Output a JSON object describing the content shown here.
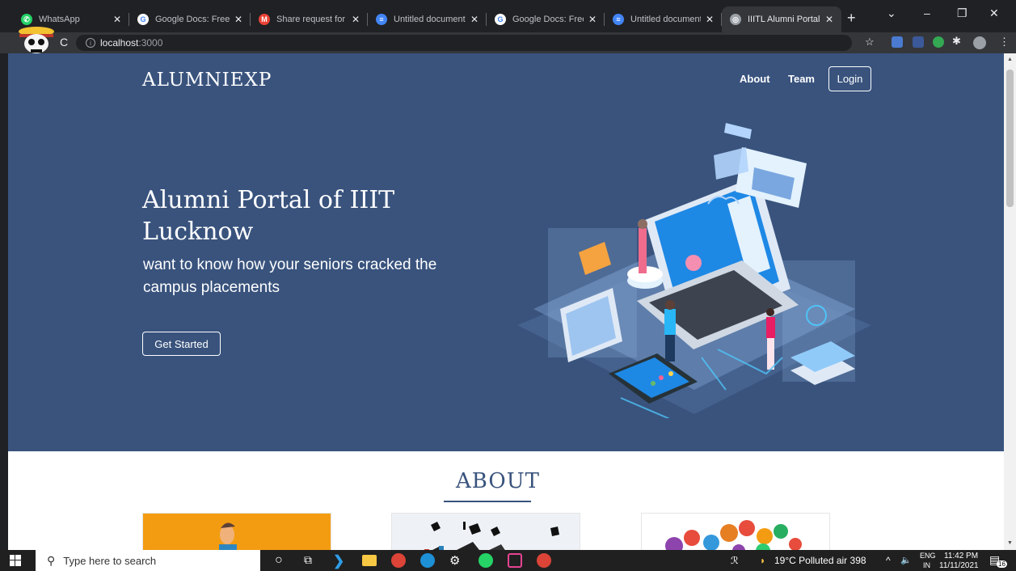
{
  "browser": {
    "tabs": [
      {
        "title": "WhatsApp",
        "icon": "whatsapp-icon",
        "color": "#25d366",
        "glyph": "✆"
      },
      {
        "title": "Google Docs: Free On",
        "icon": "google-icon",
        "color": "#ffffff",
        "glyph": "G"
      },
      {
        "title": "Share request for \"Un",
        "icon": "gmail-icon",
        "color": "#ea4335",
        "glyph": "M"
      },
      {
        "title": "Untitled document - G",
        "icon": "docs-icon",
        "color": "#4285f4",
        "glyph": "≡"
      },
      {
        "title": "Google Docs: Free On",
        "icon": "google-icon",
        "color": "#ffffff",
        "glyph": "G"
      },
      {
        "title": "Untitled document - G",
        "icon": "docs-icon",
        "color": "#4285f4",
        "glyph": "≡"
      },
      {
        "title": "IIITL Alumni Portal",
        "icon": "globe-icon",
        "color": "#9aa0a6",
        "glyph": "◎"
      }
    ],
    "new_tab": "+",
    "url_host": "localhost",
    "url_port": ":3000"
  },
  "site": {
    "brand": "ALUMNIEXP",
    "nav": {
      "about": "About",
      "team": "Team",
      "login": "Login"
    },
    "hero": {
      "title": "Alumni Portal of IIIT Lucknow",
      "subtitle": "want to know how your seniors cracked the campus placements",
      "cta": "Get Started"
    },
    "about": {
      "title": "ABOUT"
    },
    "colors": {
      "primary": "#39537d",
      "white": "#ffffff"
    }
  },
  "taskbar": {
    "search_placeholder": "Type here to search",
    "weather": "19°C  Polluted air 398",
    "lang_top": "ENG",
    "lang_bottom": "IN",
    "time": "11:42 PM",
    "date": "11/11/2021",
    "notification_count": "16"
  }
}
